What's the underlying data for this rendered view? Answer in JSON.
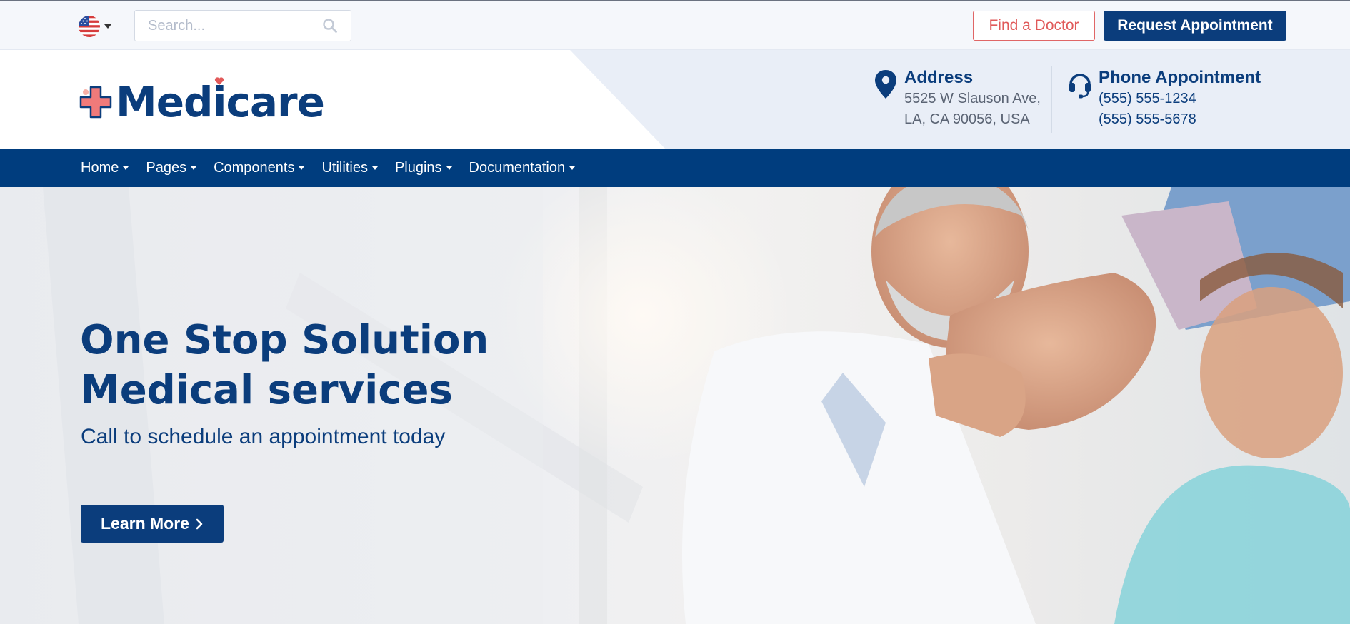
{
  "topbar": {
    "language_flag": "us-flag-icon",
    "search_placeholder": "Search...",
    "find_doctor_label": "Find a Doctor",
    "request_appointment_label": "Request Appointment"
  },
  "header": {
    "logo_text": "Medicare",
    "address": {
      "title": "Address",
      "line1": "5525 W Slauson Ave,",
      "line2": "LA, CA 90056, USA"
    },
    "phone": {
      "title": "Phone Appointment",
      "line1": "(555) 555-1234",
      "line2": "(555) 555-5678"
    }
  },
  "nav": {
    "items": [
      {
        "label": "Home"
      },
      {
        "label": "Pages"
      },
      {
        "label": "Components"
      },
      {
        "label": "Utilities"
      },
      {
        "label": "Plugins"
      },
      {
        "label": "Documentation"
      }
    ]
  },
  "hero": {
    "title_line1": "One Stop Solution",
    "title_line2": "Medical services",
    "subtitle": "Call to schedule an appointment today",
    "cta_label": "Learn More"
  },
  "colors": {
    "brand_navy": "#0b3d7c",
    "nav_blue": "#003d7e",
    "accent_red": "#e05a5a"
  }
}
